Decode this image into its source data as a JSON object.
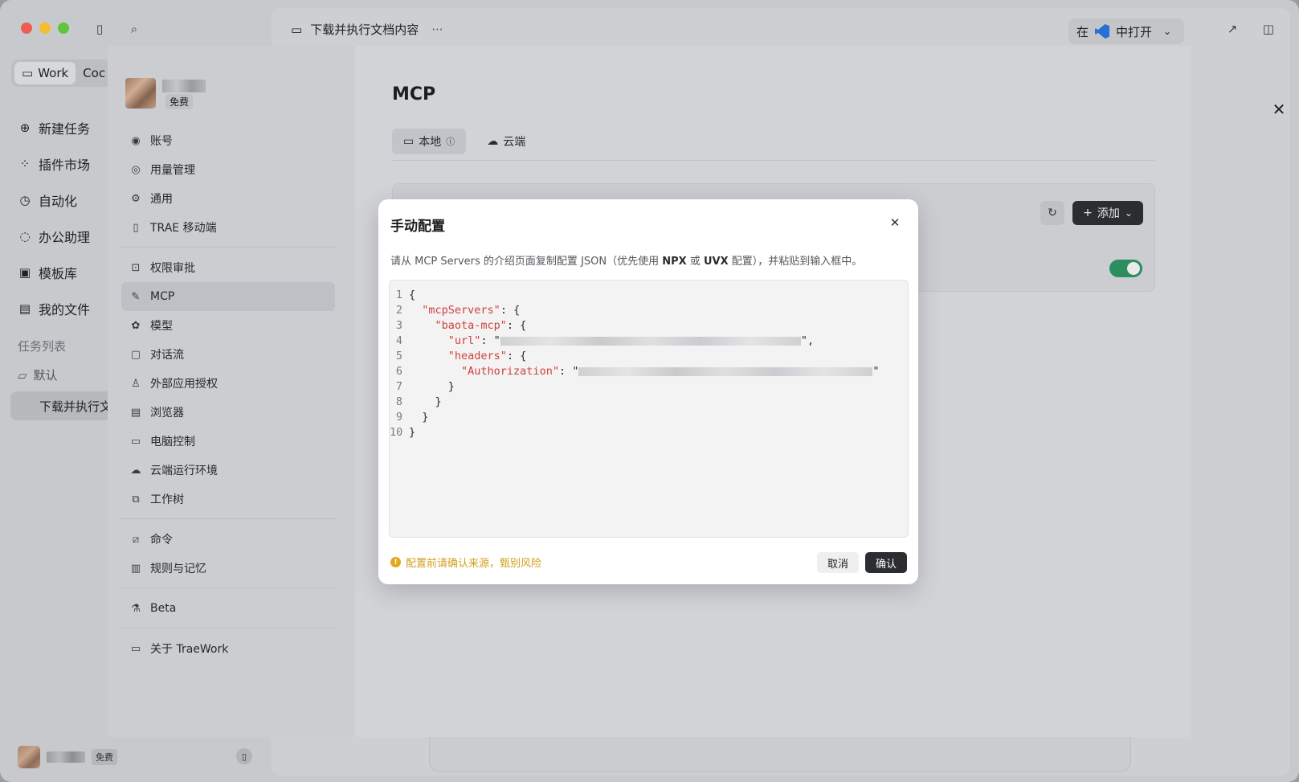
{
  "app": {
    "mode_tabs": [
      "Work",
      "Coc"
    ],
    "nav": [
      "新建任务",
      "插件市场",
      "自动化",
      "办公助理",
      "模板库",
      "我的文件"
    ],
    "task_list_title": "任务列表",
    "folder": "默认",
    "active_task": "下载并执行文",
    "user_badge": "免费"
  },
  "header": {
    "title": "下载并执行文档内容",
    "more": "···",
    "open_in_prefix": "在",
    "open_in_suffix": "中打开"
  },
  "settings": {
    "profile_badge": "免费",
    "menu": [
      {
        "label": "账号",
        "icon": "user-circle-icon"
      },
      {
        "label": "用量管理",
        "icon": "usage-icon"
      },
      {
        "label": "通用",
        "icon": "gear-icon"
      },
      {
        "label": "TRAE 移动端",
        "icon": "phone-icon"
      },
      {
        "label": "权限审批",
        "icon": "lock-icon"
      },
      {
        "label": "MCP",
        "icon": "wrench-icon"
      },
      {
        "label": "模型",
        "icon": "model-icon"
      },
      {
        "label": "对话流",
        "icon": "chat-flow-icon"
      },
      {
        "label": "外部应用授权",
        "icon": "user-auth-icon"
      },
      {
        "label": "浏览器",
        "icon": "browser-icon"
      },
      {
        "label": "电脑控制",
        "icon": "monitor-icon"
      },
      {
        "label": "云端运行环境",
        "icon": "cloud-icon"
      },
      {
        "label": "工作树",
        "icon": "worktree-icon"
      },
      {
        "label": "命令",
        "icon": "command-icon"
      },
      {
        "label": "规则与记忆",
        "icon": "book-icon"
      },
      {
        "label": "Beta",
        "icon": "flask-icon"
      },
      {
        "label": "关于 TraeWork",
        "icon": "info-card-icon"
      }
    ],
    "page_title": "MCP",
    "tabs": [
      "本地",
      "云端"
    ],
    "add_label": "添加",
    "toggle_on": true
  },
  "modal": {
    "title": "手动配置",
    "desc_parts": [
      "请从 MCP Servers 的介绍页面复制配置 JSON（优先使用 ",
      "NPX",
      " 或 ",
      "UVX",
      " 配置），并粘贴到输入框中。"
    ],
    "code": {
      "k_mcp": "\"mcpServers\"",
      "k_baota": "\"baota-mcp\"",
      "k_url": "\"url\"",
      "k_headers": "\"headers\"",
      "k_auth": "\"Authorization\""
    },
    "warning": "配置前请确认来源，甄别风险",
    "cancel": "取消",
    "confirm": "确认"
  },
  "colors": {
    "accent_dark": "#2b2d31",
    "toggle_green": "#2c8d5e",
    "json_key": "#d0403b",
    "warning": "#d4a01c"
  }
}
